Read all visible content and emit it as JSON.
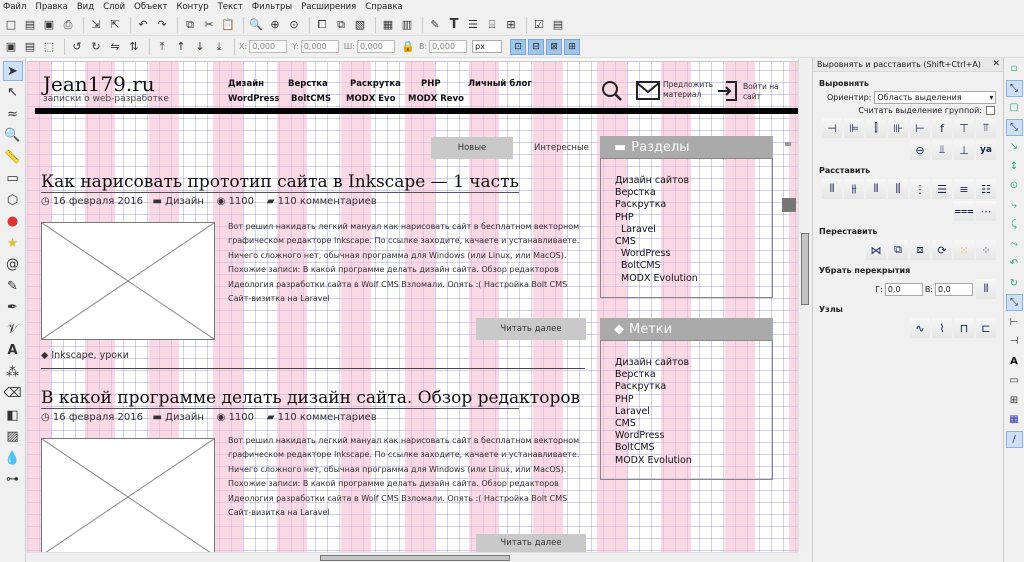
{
  "menu": [
    "Файл",
    "Правка",
    "Вид",
    "Слой",
    "Объект",
    "Контур",
    "Текст",
    "Фильтры",
    "Расширения",
    "Справка"
  ],
  "toolbar2": {
    "x_label": "X:",
    "x_value": "0,000",
    "y_label": "Y:",
    "y_value": "0,000",
    "w_label": "Ш:",
    "w_value": "0,000",
    "h_label": "В:",
    "h_value": "0,000",
    "unit": "px"
  },
  "panel": {
    "title": "Выровнять и расставить (Shift+Ctrl+A)",
    "align": "Выровнять",
    "orient_label": "Ориентир:",
    "orient_value": "Область выделения",
    "group_label": "Считать выделение группой:",
    "distribute": "Расставить",
    "rearrange": "Переставить",
    "overlap": "Убрать перекрытия",
    "h_label": "Г:",
    "h_value": "0,0",
    "v_label": "В:",
    "v_value": "0,0",
    "nodes": "Узлы"
  },
  "site": {
    "logo": "Jean179.ru",
    "tagline": "записки о web-разработке",
    "nav_row1": [
      "Дизайн",
      "Верстка",
      "Раскрутка",
      "PHP",
      "Личный блог"
    ],
    "nav_row2": [
      "WordPress",
      "BoltCMS",
      "MODX Evo",
      "MODX Revo"
    ],
    "propose": "Предложить материал",
    "login": "Войти на сайт",
    "tab_new": "Новые",
    "tab_interesting": "Интересные",
    "post1_title": "Как нарисовать прототип сайта в Inkscape — 1 часть",
    "post2_title": "В какой программе делать дизайн сайта. Обзор редакторов",
    "date": "16 февраля 2016",
    "category": "Дизайн",
    "views": "1100",
    "comments": "110 комментариев",
    "excerpt": [
      "Вот решил накидать легкий мануал как нарисовать сайт в бесплатном векторном",
      "графическом редакторе Inkscape. По ссылке заходите, качаете и устанавливаете.",
      "Ничего сложного нет, обычная программа для Windows (или Linux, или MacOS).",
      "Похожие записи: В какой программе делать дизайн сайта. Обзор редакторов",
      "Идеология разработки сайта в Wolf CMS Взломали. Опять :( Настройка Bolt CMS",
      "Сайт-визитка на Laravel"
    ],
    "read_more": "Читать далее",
    "tags": "Inkscape, уроки",
    "sections_title": "Разделы",
    "sections": [
      "Дизайн сайтов",
      "Верстка",
      "Раскрутка",
      "PHP",
      "  Laravel",
      "CMS",
      "  WordPress",
      "  BoltCMS",
      "  MODX Evolution"
    ],
    "tags_title": "Метки",
    "tag_list": [
      "Дизайн сайтов",
      "Верстка",
      "Раскрутка",
      "PHP",
      "Laravel",
      "CMS",
      "WordPress",
      "BoltCMS",
      "MODX Evolution"
    ]
  }
}
